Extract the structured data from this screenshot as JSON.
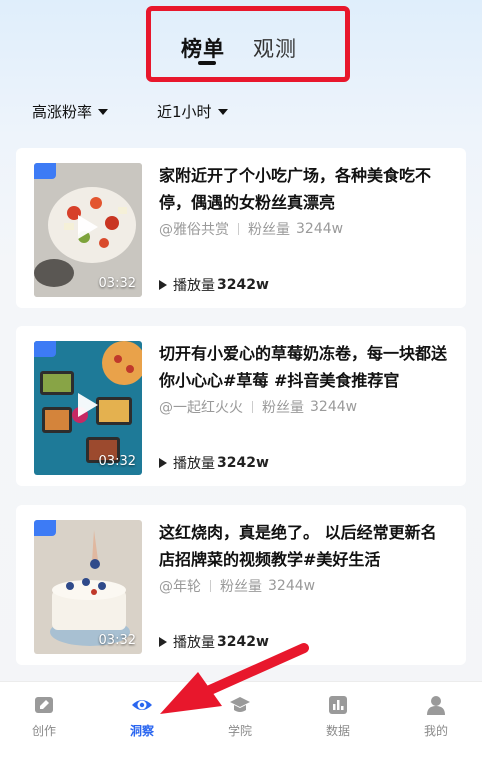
{
  "header": {
    "tabs": [
      {
        "label": "榜单",
        "active": true
      },
      {
        "label": "观测",
        "active": false
      }
    ]
  },
  "filters": {
    "sort": "高涨粉率",
    "time": "近1小时"
  },
  "videos": [
    {
      "title": "家附近开了个小吃广场，各种美食吃不停，偶遇的女粉丝真漂亮",
      "author": "@雅俗共赏",
      "fans_label": "粉丝量",
      "fans": "3244w",
      "plays_label": "播放量",
      "plays": "3242w",
      "duration": "03:32"
    },
    {
      "title": "切开有小爱心的草莓奶冻卷，每一块都送你小心心#草莓 #抖音美食推荐官",
      "author": "@一起红火火",
      "fans_label": "粉丝量",
      "fans": "3244w",
      "plays_label": "播放量",
      "plays": "3242w",
      "duration": "03:32"
    },
    {
      "title": "这红烧肉，真是绝了。 以后经常更新名店招牌菜的视频教学#美好生活",
      "author": "@年轮",
      "fans_label": "粉丝量",
      "fans": "3244w",
      "plays_label": "播放量",
      "plays": "3242w",
      "duration": "03:32"
    }
  ],
  "bottom_nav": [
    {
      "label": "创作",
      "icon": "pen-icon",
      "active": false
    },
    {
      "label": "洞察",
      "icon": "eye-icon",
      "active": true
    },
    {
      "label": "学院",
      "icon": "graduation-cap-icon",
      "active": false
    },
    {
      "label": "数据",
      "icon": "bar-chart-icon",
      "active": false
    },
    {
      "label": "我的",
      "icon": "user-icon",
      "active": false
    }
  ],
  "colors": {
    "accent": "#2a66f0",
    "highlight_box": "#e8172c",
    "annotation_arrow": "#e8172c",
    "badge": "#3d7bf5"
  }
}
